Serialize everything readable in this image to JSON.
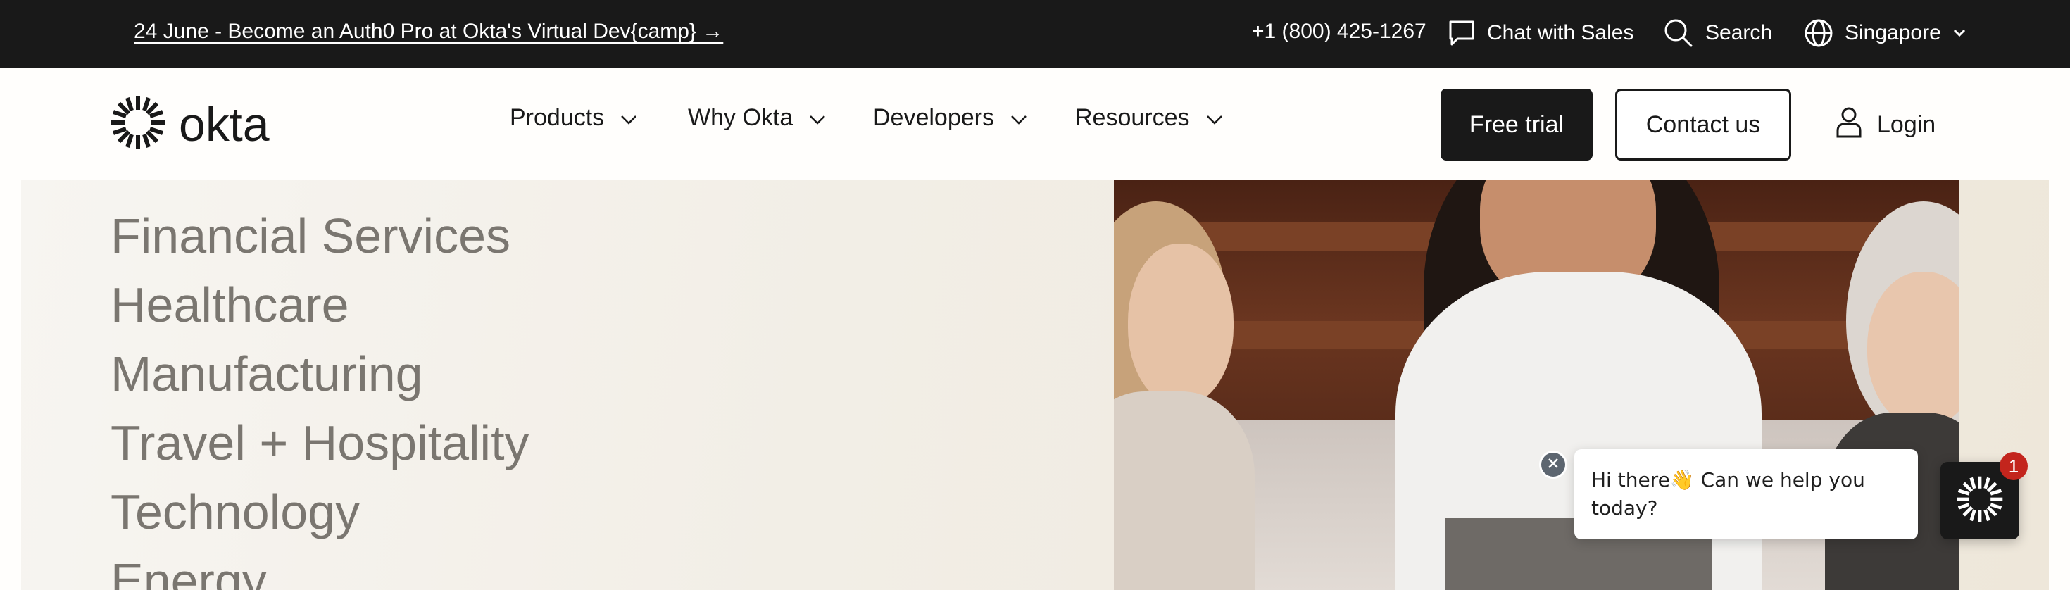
{
  "topbar": {
    "promo": "24 June - Become an Auth0 Pro at Okta's Virtual Dev{camp} →",
    "phone": "+1 (800) 425-1267",
    "chat_label": "Chat with Sales",
    "search_label": "Search",
    "region_label": "Singapore"
  },
  "nav": {
    "logo_text": "okta",
    "menu": [
      {
        "label": "Products"
      },
      {
        "label": "Why Okta"
      },
      {
        "label": "Developers"
      },
      {
        "label": "Resources"
      }
    ],
    "free_trial": "Free trial",
    "contact_us": "Contact us",
    "login": "Login"
  },
  "hero": {
    "industries": [
      "Financial Services",
      "Healthcare",
      "Manufacturing",
      "Travel + Hospitality",
      "Technology",
      "Energy"
    ]
  },
  "chat_widget": {
    "message": "Hi there👋 Can we help you today?",
    "unread_count": "1"
  },
  "icons": {
    "chat": "chat-bubble-icon",
    "search": "magnifier-icon",
    "region": "globe-icon",
    "dropdown": "chevron-down-icon",
    "login": "user-icon",
    "logo": "okta-sunburst-logo"
  },
  "colors": {
    "topbar_bg": "#191919",
    "primary_button_bg": "#191919",
    "industry_text": "#7a7670",
    "badge_red": "#c3251d"
  }
}
